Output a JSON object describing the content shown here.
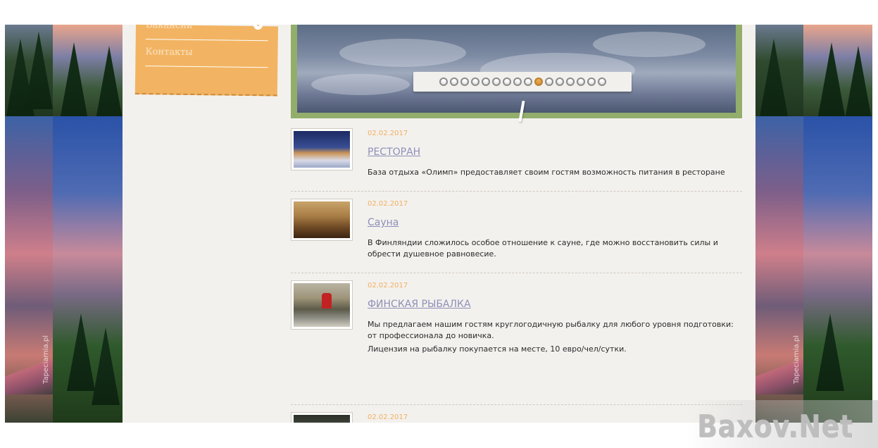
{
  "sidebar_menu": {
    "items": [
      {
        "label": "Вакансии"
      },
      {
        "label": "Контакты"
      }
    ]
  },
  "slider": {
    "dot_count": 16,
    "active_index": 9
  },
  "news": [
    {
      "date": "02.02.2017",
      "title": "РЕСТОРАН",
      "text": "База отдыха «Олимп» предоставляет своим гостям возможность питания в ресторане",
      "thumb": "restaurant-photo"
    },
    {
      "date": "02.02.2017",
      "title": "Сауна",
      "text": "В Финляндии сложилось особое отношение к сауне, где можно восстановить силы и обрести душевное равновесие.",
      "thumb": "sauna-photo"
    },
    {
      "date": "02.02.2017",
      "title": "ФИНСКАЯ РЫБАЛКА",
      "text": "Мы предлагаем нашим гостям  круглогодичную рыбалку для любого уровня подготовки: от профессионала до новичка.",
      "text2": "Лицензия на рыбалку покупается на месте, 10 евро/чел/сутки.",
      "thumb": "fishing-photo"
    },
    {
      "date": "02.02.2017",
      "thumb": "forest-photo"
    }
  ],
  "background": {
    "watermark_left": "Tapeciarnia.pl",
    "watermark_right": "Tapeciarnia.pl"
  },
  "site_watermark": "Baxov.Net",
  "colors": {
    "menu_bg": "#f2b462",
    "slider_frame": "#93ad6b",
    "date": "#f0b060",
    "title_link": "#8e8fb8",
    "page_bg": "#f3f1ee"
  }
}
